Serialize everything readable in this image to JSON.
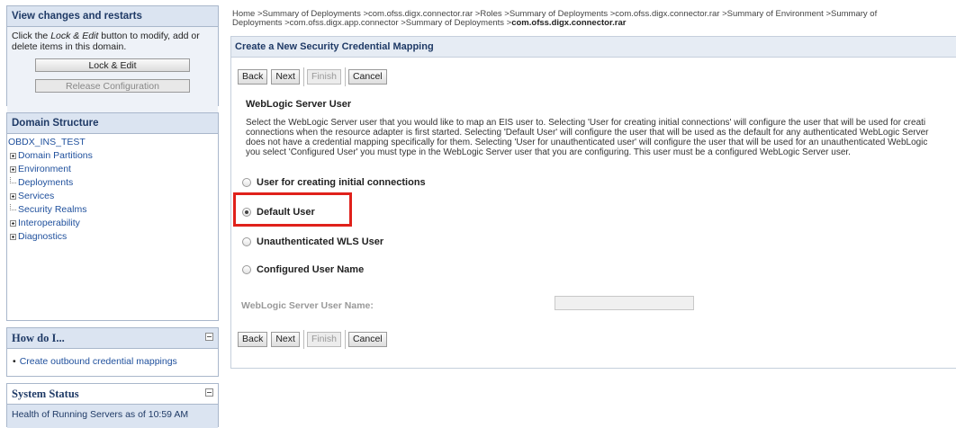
{
  "change_center": {
    "title": "View changes and restarts",
    "help_prefix": "Click the ",
    "help_emph": "Lock & Edit",
    "help_suffix": " button to modify, add or delete items in this domain.",
    "lock_edit_label": "Lock & Edit",
    "release_label": "Release Configuration"
  },
  "domain_structure": {
    "title": "Domain Structure",
    "root": "OBDX_INS_TEST",
    "items": [
      {
        "label": "Domain Partitions",
        "expandable": true
      },
      {
        "label": "Environment",
        "expandable": true
      },
      {
        "label": "Deployments",
        "expandable": false
      },
      {
        "label": "Services",
        "expandable": true
      },
      {
        "label": "Security Realms",
        "expandable": false
      },
      {
        "label": "Interoperability",
        "expandable": true
      },
      {
        "label": "Diagnostics",
        "expandable": true
      }
    ]
  },
  "how_do_i": {
    "title": "How do I...",
    "link": "Create outbound credential mappings"
  },
  "system_status": {
    "title": "System Status",
    "health_text": "Health of Running Servers as of  10:59 AM"
  },
  "breadcrumb": {
    "line1": "Home >Summary of Deployments >com.ofss.digx.connector.rar >Roles >Summary of Deployments >com.ofss.digx.connector.rar >Summary of Environment >Summary of",
    "line2_prefix": "Deployments >com.ofss.digx.app.connector >Summary of Deployments >",
    "line2_current": "com.ofss.digx.connector.rar"
  },
  "main": {
    "title": "Create a New Security Credential Mapping",
    "buttons": {
      "back": "Back",
      "next": "Next",
      "finish": "Finish",
      "cancel": "Cancel"
    },
    "section_title": "WebLogic Server User",
    "description": [
      "Select the WebLogic Server user that you would like to map an EIS user to. Selecting 'User for creating initial connections' will configure the user that will be used for creati",
      "connections when the resource adapter is first started. Selecting 'Default User' will configure the user that will be used as the default for any authenticated WebLogic Server",
      "does not have a credential mapping specifically for them. Selecting 'User for unauthenticated user' will configure the user that will be used for an unauthenticated WebLogic",
      "you select 'Configured User' you must type in the WebLogic Server user that you are configuring. This user must be a configured WebLogic Server user."
    ],
    "options": [
      {
        "label": "User for creating initial connections",
        "selected": false
      },
      {
        "label": "Default User",
        "selected": true
      },
      {
        "label": "Unauthenticated WLS User",
        "selected": false
      },
      {
        "label": "Configured User Name",
        "selected": false
      }
    ],
    "user_name_label": "WebLogic Server User Name:",
    "user_name_value": ""
  },
  "colors": {
    "highlight": "#e0211b",
    "panel_header": "#dbe4f1",
    "link": "#1e4f9c"
  }
}
